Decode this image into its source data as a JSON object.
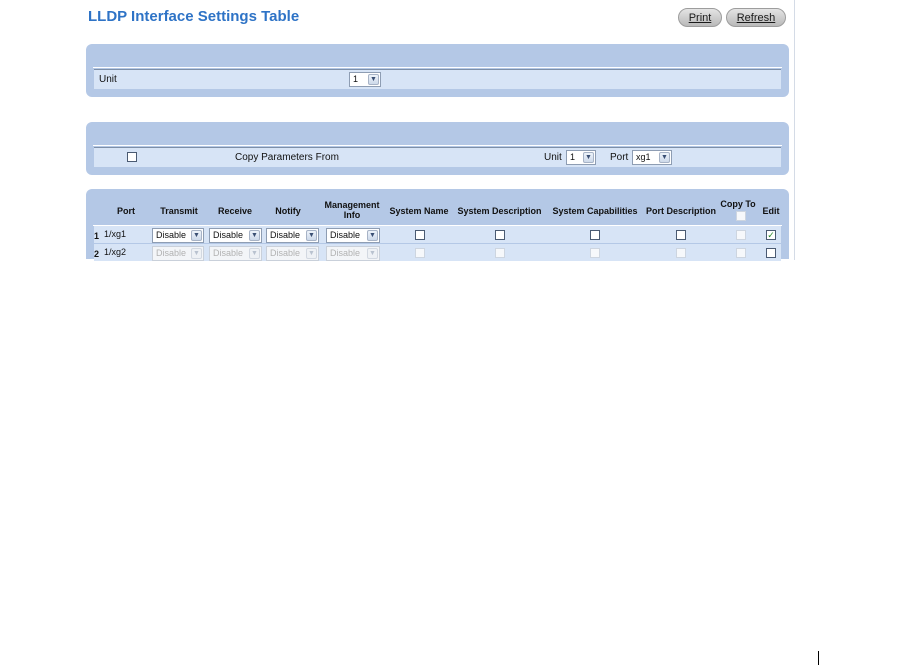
{
  "page": {
    "title": "LLDP Interface Settings Table",
    "buttons": {
      "print": "Print",
      "refresh": "Refresh"
    }
  },
  "unit_panel": {
    "label": "Unit",
    "unit_value": "1"
  },
  "copy_panel": {
    "label": "Copy Parameters From",
    "unit_label": "Unit",
    "unit_value": "1",
    "port_label": "Port",
    "port_value": "xg1"
  },
  "table": {
    "headers": {
      "port": "Port",
      "transmit": "Transmit",
      "receive": "Receive",
      "notify": "Notify",
      "management_info": "Management Info",
      "system_name": "System Name",
      "system_description": "System Description",
      "system_capabilities": "System Capabilities",
      "port_description": "Port Description",
      "copy_to": "Copy To",
      "edit": "Edit"
    },
    "rows": [
      {
        "num": "1",
        "port": "1/xg1",
        "transmit": "Disable",
        "receive": "Disable",
        "notify": "Disable",
        "management_info": "Disable",
        "edit_checked": true,
        "enabled": true
      },
      {
        "num": "2",
        "port": "1/xg2",
        "transmit": "Disable",
        "receive": "Disable",
        "notify": "Disable",
        "management_info": "Disable",
        "edit_checked": false,
        "enabled": false
      }
    ]
  },
  "icons": {
    "dropdown": "chevron-down-icon",
    "check": "checkmark-icon"
  },
  "colors": {
    "title": "#2e73c6",
    "panel": "#b4c8e6",
    "band": "#d7e4f6"
  }
}
